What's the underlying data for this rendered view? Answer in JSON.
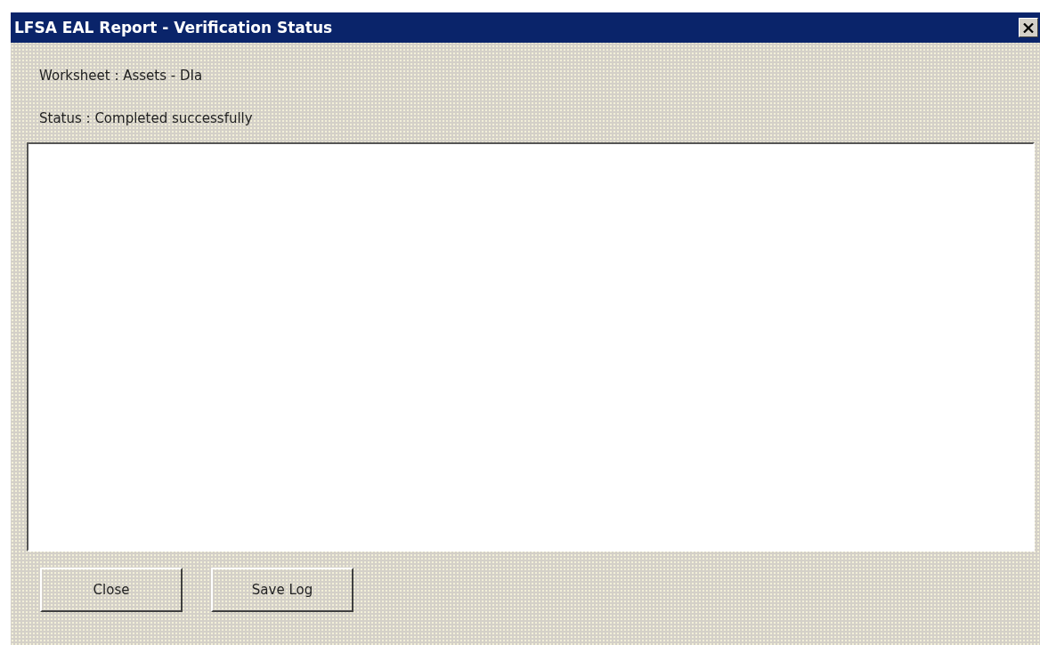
{
  "window": {
    "title": "LFSA EAL Report - Verification Status"
  },
  "fields": [
    {
      "label": "Worksheet : Assets - DIa"
    },
    {
      "label": "Status : Completed successfully"
    }
  ],
  "buttons": [
    "Close",
    "Save Log"
  ]
}
